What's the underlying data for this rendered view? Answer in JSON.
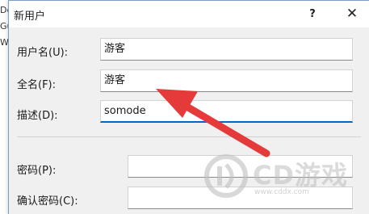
{
  "background_window": {
    "fragments": [
      "De",
      "Gui",
      "Wi"
    ]
  },
  "dialog": {
    "title": "新用户",
    "help_label": "?",
    "close_label": "✕",
    "fields": {
      "username": {
        "label": "用户名(U):",
        "value": "游客"
      },
      "fullname": {
        "label": "全名(F):",
        "value": "游客"
      },
      "description": {
        "label": "描述(D):",
        "value": "somode"
      },
      "password": {
        "label": "密码(P):",
        "value": ""
      },
      "confirm_password": {
        "label": "确认密码(C):",
        "value": ""
      }
    }
  },
  "watermark": {
    "text": "CD游戏",
    "url": "www.cddx.com"
  },
  "colors": {
    "accent": "#0067c0",
    "annotation_arrow": "#e53a3a"
  },
  "icons": {
    "watermark_logo": "cd-logo-icon",
    "annotation": "red-arrow-icon"
  }
}
